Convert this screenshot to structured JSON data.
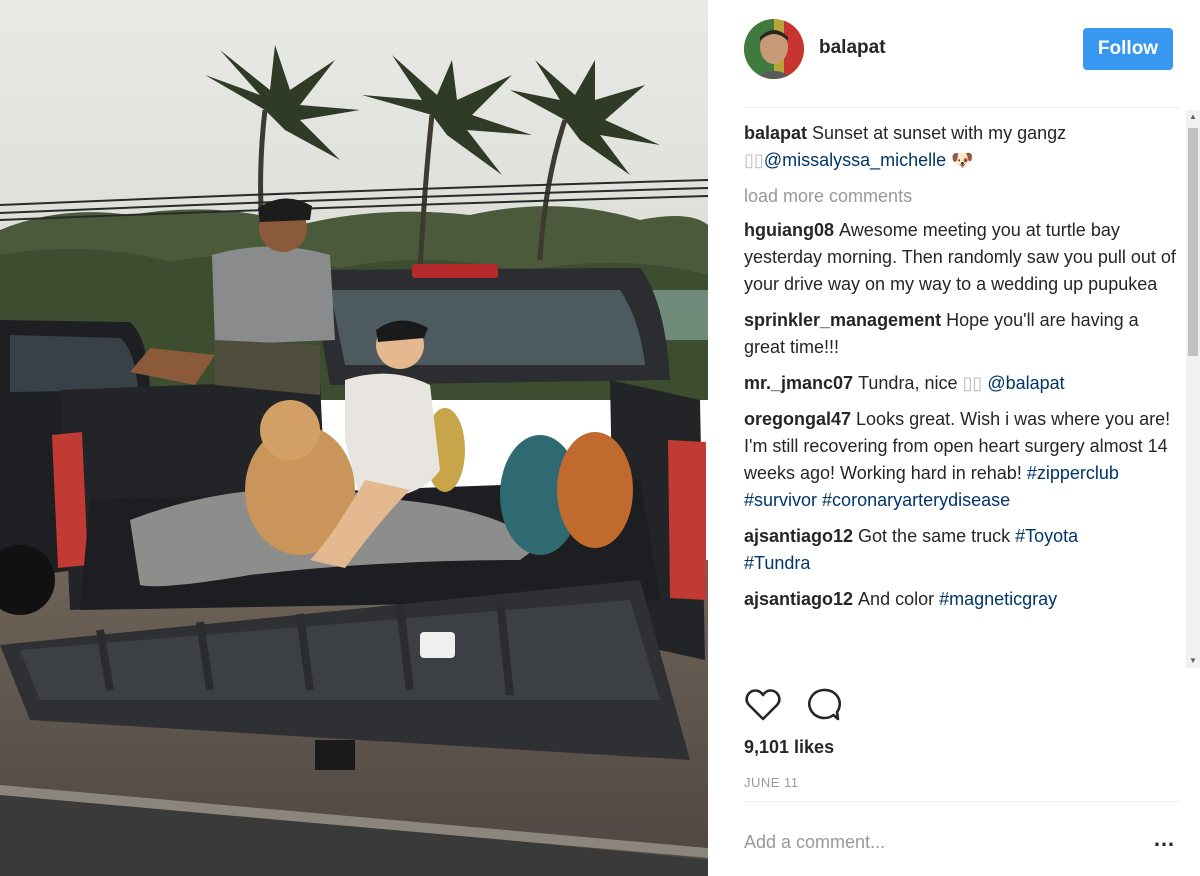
{
  "header": {
    "username": "balapat",
    "follow_label": "Follow"
  },
  "caption": {
    "username": "balapat",
    "text": "Sunset at sunset with my gangz",
    "emoji": "▯▯",
    "mention": "@missalyssa_michelle",
    "trailing_emoji": "🐶"
  },
  "load_more_label": "load more comments",
  "comments": [
    {
      "username": "hguiang08",
      "text": "Awesome meeting you at turtle bay yesterday morning. Then randomly saw you pull out of your drive way on my way to a wedding up pupukea"
    },
    {
      "username": "sprinkler_management",
      "text": "Hope you'll are having a great time!!!"
    },
    {
      "username": "mr._jmanc07",
      "text": "Tundra, nice",
      "emoji": "▯▯",
      "mention": "@balapat"
    },
    {
      "username": "oregongal47",
      "text": "Looks great. Wish i was where you are! I'm still recovering from open heart surgery almost 14 weeks ago! Working hard in rehab!",
      "tags": [
        "#zipperclub",
        "#survivor",
        "#coronaryarterydisease"
      ]
    },
    {
      "username": "ajsantiago12",
      "text": "Got the same truck",
      "tags": [
        "#Toyota",
        "#Tundra"
      ]
    },
    {
      "username": "ajsantiago12",
      "text": "And color",
      "tags": [
        "#magneticgray"
      ]
    }
  ],
  "likes": "9,101 likes",
  "date": "JUNE 11",
  "add_comment_placeholder": "Add a comment...",
  "more_options_label": "…",
  "icons": {
    "like": "heart-icon",
    "comment": "comment-bubble-icon",
    "scroll_up": "scroll-up-arrow-icon",
    "scroll_down": "scroll-down-arrow-icon"
  },
  "colors": {
    "follow_button": "#3897f0",
    "link": "#003569",
    "muted": "#999999",
    "text": "#262626"
  }
}
